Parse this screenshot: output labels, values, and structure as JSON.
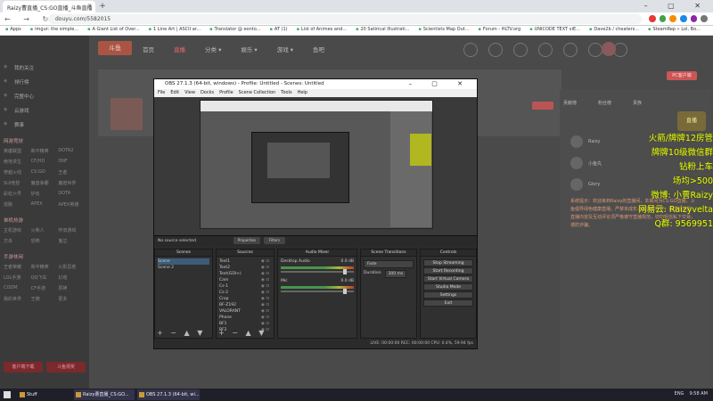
{
  "browser": {
    "tab_title": "Raizy曹直播_CS:GO直播_斗鱼直播",
    "tab_close": "×",
    "new_tab": "+",
    "window_controls": "– ▢ ✕",
    "nav_icons": "← → ↻ ⌂",
    "url": "douyu.com/5582015",
    "bookmarks": [
      "Apps",
      "imgur: the simple...",
      "A Giant List of Over...",
      "1 Line Art | ASCII ar...",
      "Translator @ eonto...",
      "AT (1)",
      "List of Animes and...",
      "20 Satirical Illustrati...",
      "Scientists Map Out...",
      "Forum - HLTV.org",
      "UNICODE TEXT viE...",
      "Dave2b / cheaters...",
      "SteamRep » Lol, Bo..."
    ],
    "ext_colors": [
      "#e53935",
      "#43a047",
      "#fb8c00",
      "#1e88e5",
      "#8e24aa",
      "#757575"
    ]
  },
  "site": {
    "logo": "斗鱼",
    "nav": [
      "首页",
      "直播",
      "分类 ▾",
      "娱乐 ▾",
      "游戏 ▾",
      "鱼吧"
    ],
    "sidebar_top": [
      "我的关注",
      "排行榜",
      "完整中心",
      "云游戏",
      "赛事"
    ],
    "sidebar_sections": [
      {
        "title": "网游竞技",
        "items": [
          "英雄联盟",
          "和平精英",
          "DOTA2",
          "绝地求生",
          "CF/HD",
          "DNF",
          "穿越火线",
          "CS:GO",
          "王者",
          "SUI竞技",
          "魔兽争霸",
          "魔兽世界",
          "彩虹六号",
          "炉石",
          "DOTA",
          "逃跑",
          "APEX",
          "APEX英雄"
        ]
      },
      {
        "title": "单机热游",
        "items": [
          "主机游戏",
          "火柴人",
          "怀旧游戏",
          "方舟",
          "恐怖",
          "鬼泣"
        ]
      },
      {
        "title": "手游休闲",
        "items": [
          "王者荣耀",
          "和平精英",
          "火影忍者",
          "LOL手游",
          "QQ飞车",
          "幻塔",
          "CODM",
          "CF手游",
          "原神",
          "我的世界",
          "王牌",
          "更多"
        ]
      }
    ],
    "sidebar_buttons": [
      "客户端下载",
      "斗鱼领奖"
    ],
    "pc_button": "PC客户端",
    "chat_tabs": [
      "贡献榜",
      "粉丝榜",
      "贵族"
    ],
    "chat_users": [
      "Raizy",
      "小鱼丸",
      "Glory"
    ],
    "chat_message": "系统提示：欢迎来到Raizy的直播间，本房间为CS:GO直播，斗鱼倡导绿色健康直播，严禁未成年人直播或打赏，请理性消费。直播内容及互动评论须严格遵守直播规范，切勿轻信私下交易，谨防诈骗。",
    "overlay_lines": [
      "火箭/牌牌12房管",
      "牌牌10级微信群",
      "钻粉上车",
      "场均>500",
      "微博: 小曹Raizy",
      "网易云: Raizyvelta",
      "Q群: 9569951"
    ],
    "level_badge": "直播"
  },
  "obs": {
    "title": "OBS 27.1.3 (64-bit, windows) - Profile: Untitled - Scenes: Untitled",
    "title_buttons": "– ▢ ✕",
    "menu": [
      "File",
      "Edit",
      "View",
      "Docks",
      "Profile",
      "Scene Collection",
      "Tools",
      "Help"
    ],
    "no_source": "No source selected",
    "properties_btn": "Properties",
    "filters_btn": "Filters",
    "docks": {
      "scenes": {
        "title": "Scenes",
        "items": [
          "Scene",
          "Scene 2"
        ]
      },
      "sources": {
        "title": "Sources",
        "items": [
          "Text1",
          "Text2",
          "Text(GDI+)",
          "Cam",
          "Cs-1",
          "Cs-2",
          "Crop",
          "BF-Z192",
          "VALORANT",
          "Phone",
          "BF1",
          "BF2"
        ]
      },
      "mixer": {
        "title": "Audio Mixer",
        "channels": [
          {
            "name": "Desktop Audio",
            "db": "0.0 dB"
          },
          {
            "name": "Mic",
            "db": "0.0 dB"
          }
        ]
      },
      "transitions": {
        "title": "Scene Transitions",
        "type": "Fade",
        "duration_label": "Duration",
        "duration": "300 ms"
      },
      "controls": {
        "title": "Controls",
        "buttons": [
          "Stop Streaming",
          "Start Recording",
          "Start Virtual Camera",
          "Studio Mode",
          "Settings",
          "Exit"
        ]
      }
    },
    "dock_footer": "+ − ▲ ▼",
    "status": "LIVE: 00:00:00      REC: 00:00:00      CPU: 0.4%, 59.94 fps"
  },
  "taskbar": {
    "items": [
      "Stuff",
      "Raizy曹直播_CS:GO...",
      "OBS 27.1.3 (64-bit, wi..."
    ],
    "lang": "ENG",
    "time": "9:58 AM"
  }
}
